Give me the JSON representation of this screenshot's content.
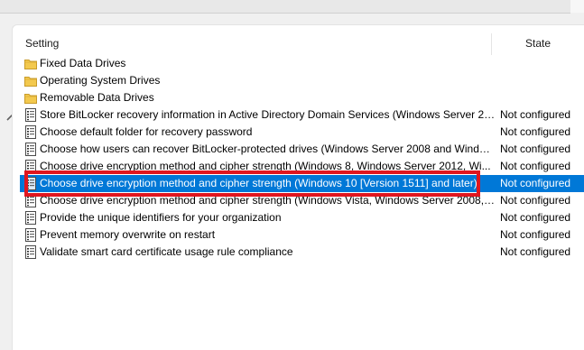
{
  "header": {
    "setting_label": "Setting",
    "state_label": "State"
  },
  "rows": [
    {
      "icon": "folder-icon",
      "label": "Fixed Data Drives",
      "state": ""
    },
    {
      "icon": "folder-icon",
      "label": "Operating System Drives",
      "state": ""
    },
    {
      "icon": "folder-icon",
      "label": "Removable Data Drives",
      "state": ""
    },
    {
      "icon": "policy-setting-icon",
      "label": "Store BitLocker recovery information in Active Directory Domain Services (Windows Server 20...",
      "state": "Not configured"
    },
    {
      "icon": "policy-setting-icon",
      "label": "Choose default folder for recovery password",
      "state": "Not configured"
    },
    {
      "icon": "policy-setting-icon",
      "label": "Choose how users can recover BitLocker-protected drives (Windows Server 2008 and Window...",
      "state": "Not configured"
    },
    {
      "icon": "policy-setting-icon",
      "label": "Choose drive encryption method and cipher strength (Windows 8, Windows Server 2012, Wi...",
      "state": "Not configured"
    },
    {
      "icon": "policy-setting-icon",
      "label": "Choose drive encryption method and cipher strength (Windows 10 [Version 1511] and later)",
      "state": "Not configured"
    },
    {
      "icon": "policy-setting-icon",
      "label": "Choose drive encryption method and cipher strength (Windows Vista, Windows Server 2008, ...",
      "state": "Not configured"
    },
    {
      "icon": "policy-setting-icon",
      "label": "Provide the unique identifiers for your organization",
      "state": "Not configured"
    },
    {
      "icon": "policy-setting-icon",
      "label": "Prevent memory overwrite on restart",
      "state": "Not configured"
    },
    {
      "icon": "policy-setting-icon",
      "label": "Validate smart card certificate usage rule compliance",
      "state": "Not configured"
    }
  ],
  "selected_index": 7,
  "colors": {
    "selection": "#0078d7",
    "highlight_box": "#e0161f"
  }
}
